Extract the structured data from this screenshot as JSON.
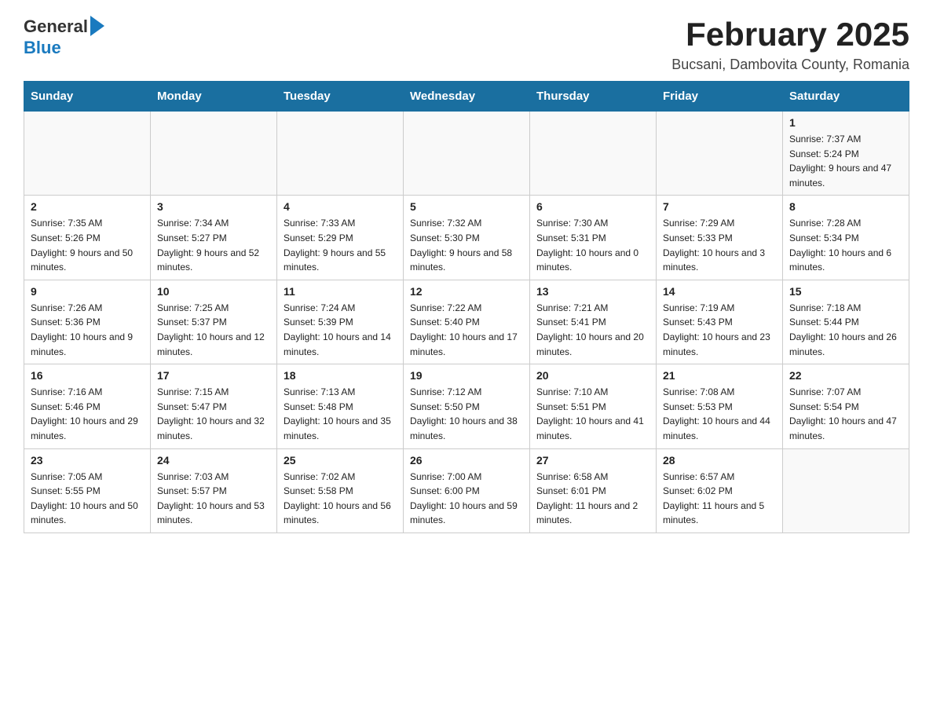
{
  "header": {
    "logo_general": "General",
    "logo_blue": "Blue",
    "month_title": "February 2025",
    "location": "Bucsani, Dambovita County, Romania"
  },
  "days_of_week": [
    "Sunday",
    "Monday",
    "Tuesday",
    "Wednesday",
    "Thursday",
    "Friday",
    "Saturday"
  ],
  "weeks": [
    {
      "days": [
        {
          "num": "",
          "info": ""
        },
        {
          "num": "",
          "info": ""
        },
        {
          "num": "",
          "info": ""
        },
        {
          "num": "",
          "info": ""
        },
        {
          "num": "",
          "info": ""
        },
        {
          "num": "",
          "info": ""
        },
        {
          "num": "1",
          "info": "Sunrise: 7:37 AM\nSunset: 5:24 PM\nDaylight: 9 hours and 47 minutes."
        }
      ]
    },
    {
      "days": [
        {
          "num": "2",
          "info": "Sunrise: 7:35 AM\nSunset: 5:26 PM\nDaylight: 9 hours and 50 minutes."
        },
        {
          "num": "3",
          "info": "Sunrise: 7:34 AM\nSunset: 5:27 PM\nDaylight: 9 hours and 52 minutes."
        },
        {
          "num": "4",
          "info": "Sunrise: 7:33 AM\nSunset: 5:29 PM\nDaylight: 9 hours and 55 minutes."
        },
        {
          "num": "5",
          "info": "Sunrise: 7:32 AM\nSunset: 5:30 PM\nDaylight: 9 hours and 58 minutes."
        },
        {
          "num": "6",
          "info": "Sunrise: 7:30 AM\nSunset: 5:31 PM\nDaylight: 10 hours and 0 minutes."
        },
        {
          "num": "7",
          "info": "Sunrise: 7:29 AM\nSunset: 5:33 PM\nDaylight: 10 hours and 3 minutes."
        },
        {
          "num": "8",
          "info": "Sunrise: 7:28 AM\nSunset: 5:34 PM\nDaylight: 10 hours and 6 minutes."
        }
      ]
    },
    {
      "days": [
        {
          "num": "9",
          "info": "Sunrise: 7:26 AM\nSunset: 5:36 PM\nDaylight: 10 hours and 9 minutes."
        },
        {
          "num": "10",
          "info": "Sunrise: 7:25 AM\nSunset: 5:37 PM\nDaylight: 10 hours and 12 minutes."
        },
        {
          "num": "11",
          "info": "Sunrise: 7:24 AM\nSunset: 5:39 PM\nDaylight: 10 hours and 14 minutes."
        },
        {
          "num": "12",
          "info": "Sunrise: 7:22 AM\nSunset: 5:40 PM\nDaylight: 10 hours and 17 minutes."
        },
        {
          "num": "13",
          "info": "Sunrise: 7:21 AM\nSunset: 5:41 PM\nDaylight: 10 hours and 20 minutes."
        },
        {
          "num": "14",
          "info": "Sunrise: 7:19 AM\nSunset: 5:43 PM\nDaylight: 10 hours and 23 minutes."
        },
        {
          "num": "15",
          "info": "Sunrise: 7:18 AM\nSunset: 5:44 PM\nDaylight: 10 hours and 26 minutes."
        }
      ]
    },
    {
      "days": [
        {
          "num": "16",
          "info": "Sunrise: 7:16 AM\nSunset: 5:46 PM\nDaylight: 10 hours and 29 minutes."
        },
        {
          "num": "17",
          "info": "Sunrise: 7:15 AM\nSunset: 5:47 PM\nDaylight: 10 hours and 32 minutes."
        },
        {
          "num": "18",
          "info": "Sunrise: 7:13 AM\nSunset: 5:48 PM\nDaylight: 10 hours and 35 minutes."
        },
        {
          "num": "19",
          "info": "Sunrise: 7:12 AM\nSunset: 5:50 PM\nDaylight: 10 hours and 38 minutes."
        },
        {
          "num": "20",
          "info": "Sunrise: 7:10 AM\nSunset: 5:51 PM\nDaylight: 10 hours and 41 minutes."
        },
        {
          "num": "21",
          "info": "Sunrise: 7:08 AM\nSunset: 5:53 PM\nDaylight: 10 hours and 44 minutes."
        },
        {
          "num": "22",
          "info": "Sunrise: 7:07 AM\nSunset: 5:54 PM\nDaylight: 10 hours and 47 minutes."
        }
      ]
    },
    {
      "days": [
        {
          "num": "23",
          "info": "Sunrise: 7:05 AM\nSunset: 5:55 PM\nDaylight: 10 hours and 50 minutes."
        },
        {
          "num": "24",
          "info": "Sunrise: 7:03 AM\nSunset: 5:57 PM\nDaylight: 10 hours and 53 minutes."
        },
        {
          "num": "25",
          "info": "Sunrise: 7:02 AM\nSunset: 5:58 PM\nDaylight: 10 hours and 56 minutes."
        },
        {
          "num": "26",
          "info": "Sunrise: 7:00 AM\nSunset: 6:00 PM\nDaylight: 10 hours and 59 minutes."
        },
        {
          "num": "27",
          "info": "Sunrise: 6:58 AM\nSunset: 6:01 PM\nDaylight: 11 hours and 2 minutes."
        },
        {
          "num": "28",
          "info": "Sunrise: 6:57 AM\nSunset: 6:02 PM\nDaylight: 11 hours and 5 minutes."
        },
        {
          "num": "",
          "info": ""
        }
      ]
    }
  ]
}
